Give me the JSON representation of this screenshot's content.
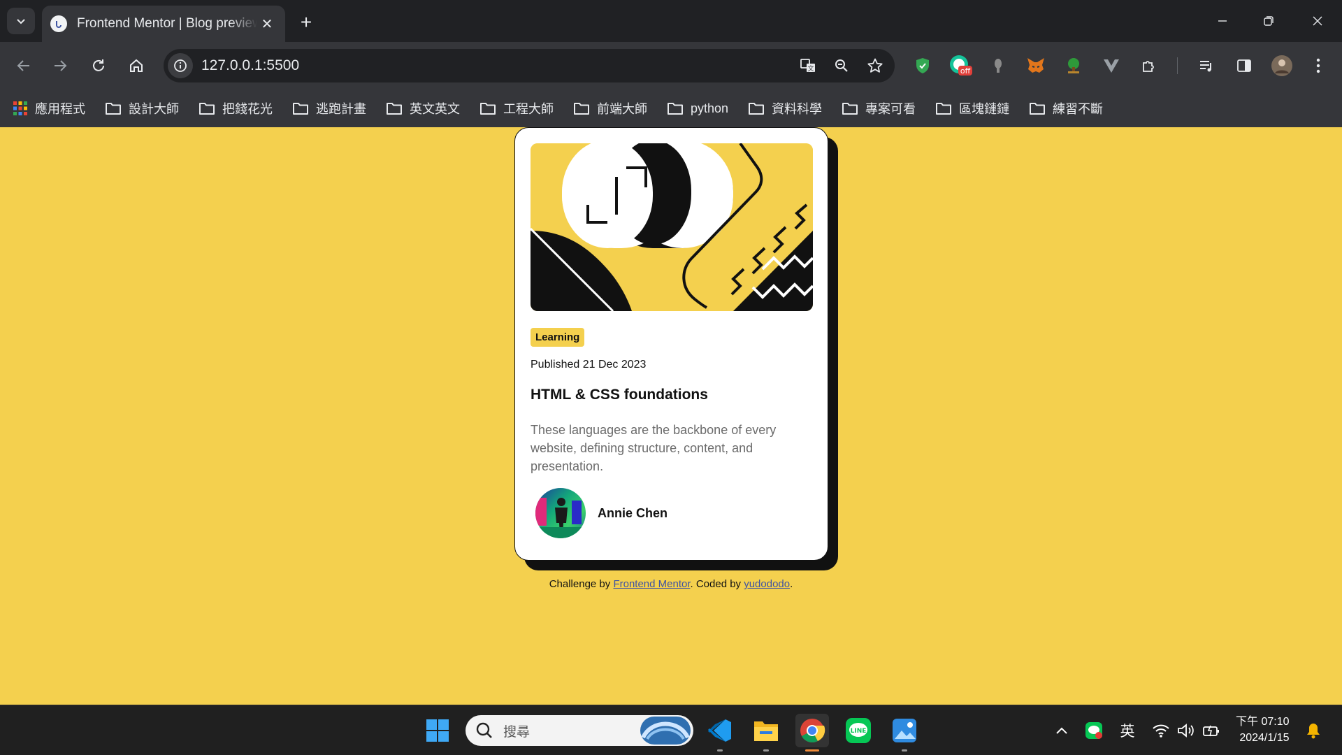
{
  "browser": {
    "tab_title": "Frontend Mentor | Blog preview card",
    "url": "127.0.0.1:5500",
    "bookmarks": [
      {
        "label": "應用程式",
        "icon": "apps-grid-icon"
      },
      {
        "label": "設計大師",
        "icon": "folder-icon"
      },
      {
        "label": "把錢花光",
        "icon": "folder-icon"
      },
      {
        "label": "逃跑計畫",
        "icon": "folder-icon"
      },
      {
        "label": "英文英文",
        "icon": "folder-icon"
      },
      {
        "label": "工程大師",
        "icon": "folder-icon"
      },
      {
        "label": "前端大師",
        "icon": "folder-icon"
      },
      {
        "label": "python",
        "icon": "folder-icon"
      },
      {
        "label": "資料科學",
        "icon": "folder-icon"
      },
      {
        "label": "專案可看",
        "icon": "folder-icon"
      },
      {
        "label": "區塊鏈鏈",
        "icon": "folder-icon"
      },
      {
        "label": "練習不斷",
        "icon": "folder-icon"
      }
    ],
    "extension_badge": "off"
  },
  "card": {
    "tag": "Learning",
    "published": "Published 21 Dec 2023",
    "title": "HTML & CSS foundations",
    "description": "These languages are the backbone of every website, defining structure, content, and presentation.",
    "author": "Annie Chen"
  },
  "attribution": {
    "prefix": "Challenge by ",
    "link1": "Frontend Mentor",
    "middle": ". Coded by ",
    "link2": "yudododo",
    "suffix": "."
  },
  "taskbar": {
    "search_placeholder": "搜尋",
    "ime": "英",
    "time": "下午 07:10",
    "date": "2024/1/15"
  },
  "colors": {
    "page_bg": "#f4d04e",
    "chrome_dark": "#202124",
    "chrome_toolbar": "#35363a",
    "link": "#3e52a3"
  }
}
